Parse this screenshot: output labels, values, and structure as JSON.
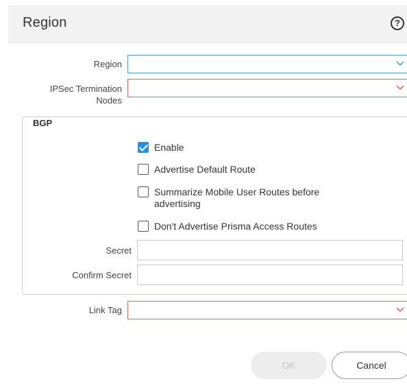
{
  "dialog": {
    "title": "Region",
    "help_icon": "question-circle-icon"
  },
  "fields": {
    "region": {
      "label": "Region",
      "value": ""
    },
    "ipsec": {
      "label_line1": "IPSec Termination",
      "label_line2": "Nodes",
      "value": ""
    },
    "link_tag": {
      "label": "Link Tag",
      "value": ""
    }
  },
  "bgp": {
    "legend": "BGP",
    "options": [
      {
        "label": "Enable",
        "checked": true
      },
      {
        "label": "Advertise Default Route",
        "checked": false
      },
      {
        "label_line1": "Summarize Mobile User Routes before",
        "label_line2": "advertising",
        "checked": false
      },
      {
        "label": "Don't Advertise Prisma Access Routes",
        "checked": false
      }
    ],
    "secret": {
      "label": "Secret",
      "value": ""
    },
    "confirm_secret": {
      "label": "Confirm Secret",
      "value": ""
    }
  },
  "buttons": {
    "ok": "OK",
    "cancel": "Cancel"
  },
  "colors": {
    "select_border_active": "#4aa3df",
    "select_border_required": "#e06666",
    "checkbox_checked": "#2f8fd8"
  }
}
